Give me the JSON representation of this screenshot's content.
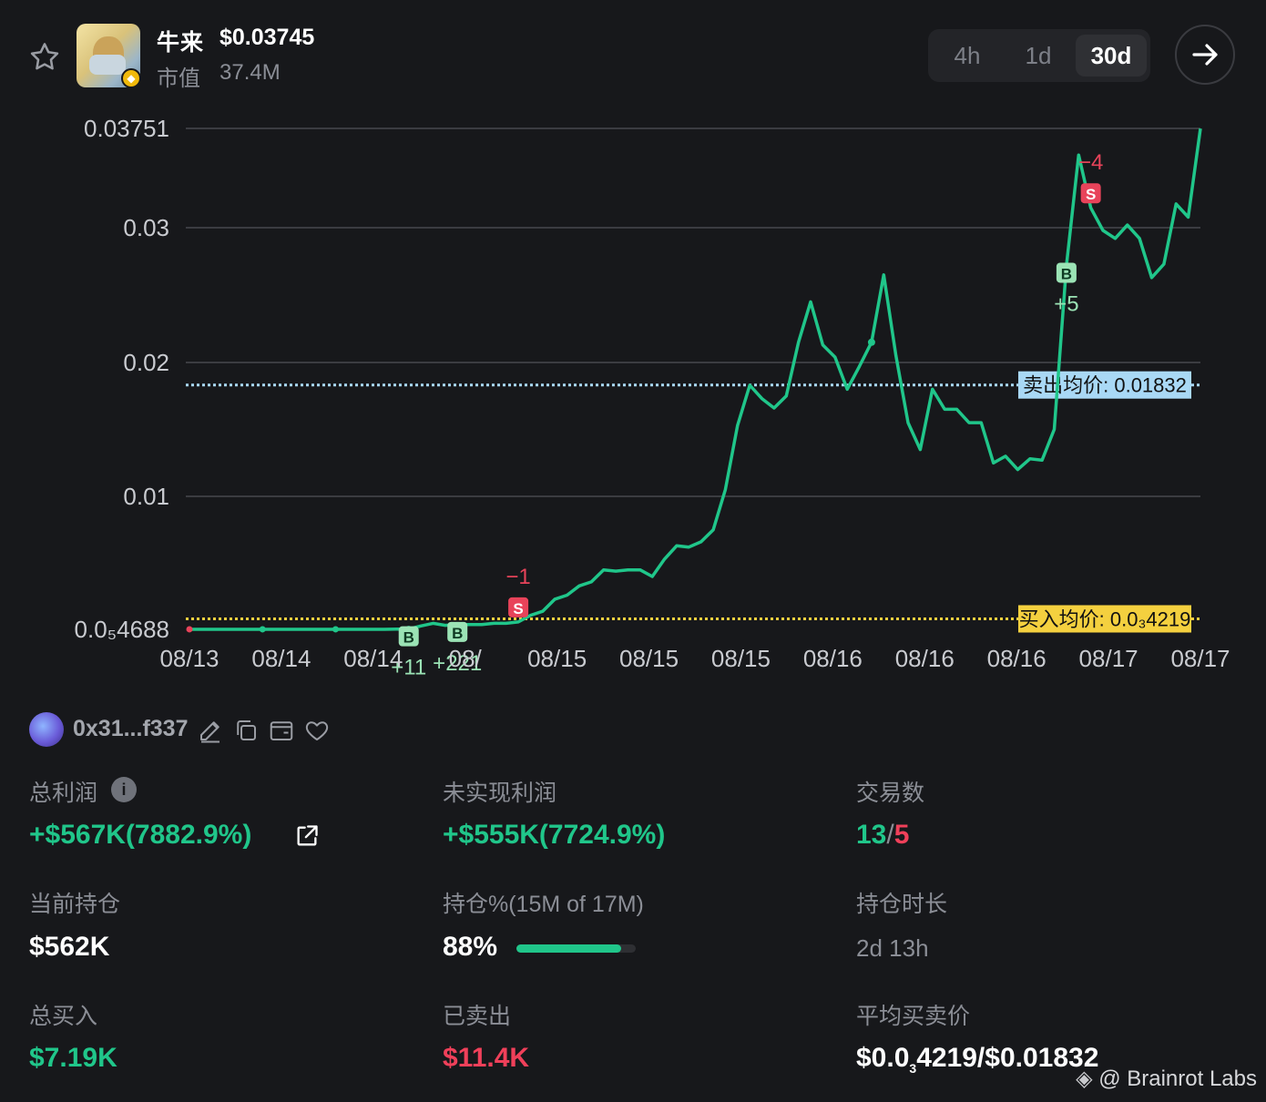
{
  "token": {
    "name": "牛来",
    "price": "$0.03745",
    "market_cap_label": "市值",
    "market_cap": "37.4M"
  },
  "timeframes": [
    {
      "label": "4h",
      "active": false
    },
    {
      "label": "1d",
      "active": false
    },
    {
      "label": "30d",
      "active": true
    }
  ],
  "icons": {
    "favorite": "star-icon",
    "next": "arrow-right-icon",
    "edit": "pencil-icon",
    "copy": "copy-icon",
    "wallet": "wallet-icon",
    "follow": "heart-icon",
    "info": "info-icon",
    "share": "external-link-icon",
    "chain": "bnb-chain-icon"
  },
  "colors": {
    "line": "#20c68a",
    "sell_marker": "#e8435a",
    "buy_marker": "#9be3b5",
    "sell_avg_line": "#a9d8f5",
    "buy_avg_line": "#f4d03f",
    "background": "#17181b"
  },
  "chart_data": {
    "type": "line",
    "y_axis_labels": [
      "0.03751",
      "0.03",
      "0.02",
      "0.01",
      "0.0₅4688"
    ],
    "x_axis_labels": [
      "08/13",
      "08/14",
      "08/14",
      "08/",
      "08/15",
      "08/15",
      "08/15",
      "08/16",
      "08/16",
      "08/16",
      "08/17",
      "08/17"
    ],
    "ylim": [
      4.69e-05,
      0.03751
    ],
    "grid": true,
    "x": [
      0,
      1,
      2,
      3,
      4,
      5,
      6,
      7,
      8,
      9,
      10,
      11,
      12,
      13,
      14,
      15,
      16,
      17,
      18,
      19,
      20,
      21,
      22,
      23,
      24,
      25,
      26,
      27,
      28,
      29,
      30,
      31,
      32,
      33,
      34,
      35,
      36,
      37,
      38,
      39,
      40,
      41,
      42,
      43,
      44,
      45,
      46,
      47,
      48,
      49,
      50,
      51,
      52,
      53,
      54,
      55,
      56,
      57,
      58,
      59,
      60,
      61,
      62,
      63,
      64,
      65,
      66,
      67,
      68,
      69,
      70,
      71,
      72,
      73,
      74,
      75,
      76,
      77,
      78,
      79,
      80,
      81,
      82,
      83,
      84,
      85,
      86,
      87,
      88,
      89,
      90,
      91,
      92,
      93,
      94,
      95,
      96,
      97
    ],
    "values": [
      5e-05,
      5e-05,
      5e-05,
      5e-05,
      5e-05,
      5e-05,
      5e-05,
      5e-05,
      5e-05,
      5e-05,
      5e-05,
      5e-05,
      5e-05,
      5e-05,
      5e-05,
      5e-05,
      5e-05,
      6e-05,
      7e-05,
      0.0003,
      0.0005,
      0.00035,
      0.0004,
      0.0004,
      0.0004,
      0.0005,
      0.0005,
      0.0006,
      0.0011,
      0.0014,
      0.0023,
      0.0026,
      0.0033,
      0.0036,
      0.0045,
      0.0044,
      0.0045,
      0.0045,
      0.004,
      0.0053,
      0.0063,
      0.0062,
      0.0066,
      0.0075,
      0.0105,
      0.0153,
      0.0183,
      0.0173,
      0.0166,
      0.0175,
      0.0215,
      0.0245,
      0.0213,
      0.0204,
      0.018,
      0.0197,
      0.0215,
      0.0265,
      0.0205,
      0.0155,
      0.0135,
      0.018,
      0.0165,
      0.0165,
      0.0155,
      0.0155,
      0.0125,
      0.013,
      0.012,
      0.0128,
      0.0127,
      0.015,
      0.0272,
      0.0355,
      0.0315,
      0.0298,
      0.0292,
      0.0302,
      0.0292,
      0.0263,
      0.0273,
      0.0318,
      0.0308,
      0.0375
    ],
    "title": "",
    "xlabel": "",
    "ylabel": "",
    "reference_lines": [
      {
        "label": "卖出均价: 0.01832",
        "value": 0.01832
      },
      {
        "label": "买入均价: 0.0₃4219",
        "value": 0.0004219
      }
    ],
    "trade_markers": [
      {
        "type": "S",
        "label": "−1",
        "index": 27
      },
      {
        "type": "S",
        "label": "−4",
        "index": 74
      },
      {
        "type": "B",
        "label": "+5",
        "index": 72
      },
      {
        "type": "B",
        "label": "+11",
        "index": 18
      },
      {
        "type": "B",
        "label": "+221",
        "index": 22
      }
    ]
  },
  "wallet": {
    "address": "0x31...f337"
  },
  "stats": {
    "total_profit": {
      "label": "总利润",
      "value": "+$567K(7882.9%)"
    },
    "unrealized_profit": {
      "label": "未实现利润",
      "value": "+$555K(7724.9%)"
    },
    "trades": {
      "label": "交易数",
      "buys": "13",
      "sep": "/",
      "sells": "5"
    },
    "current_position": {
      "label": "当前持仓",
      "value": "$562K"
    },
    "holding_pct": {
      "label": "持仓%(15M of 17M)",
      "value": "88%",
      "fraction": 0.88
    },
    "holding_duration": {
      "label": "持仓时长",
      "value": "2d 13h"
    },
    "total_buy": {
      "label": "总买入",
      "value": "$7.19K"
    },
    "sold": {
      "label": "已卖出",
      "value": "$11.4K"
    },
    "avg_prices": {
      "label": "平均买卖价",
      "value_pre": "$0.0",
      "value_sub": "3",
      "value_post": "4219/$0.01832"
    }
  },
  "watermark": "@ Brainrot Labs"
}
